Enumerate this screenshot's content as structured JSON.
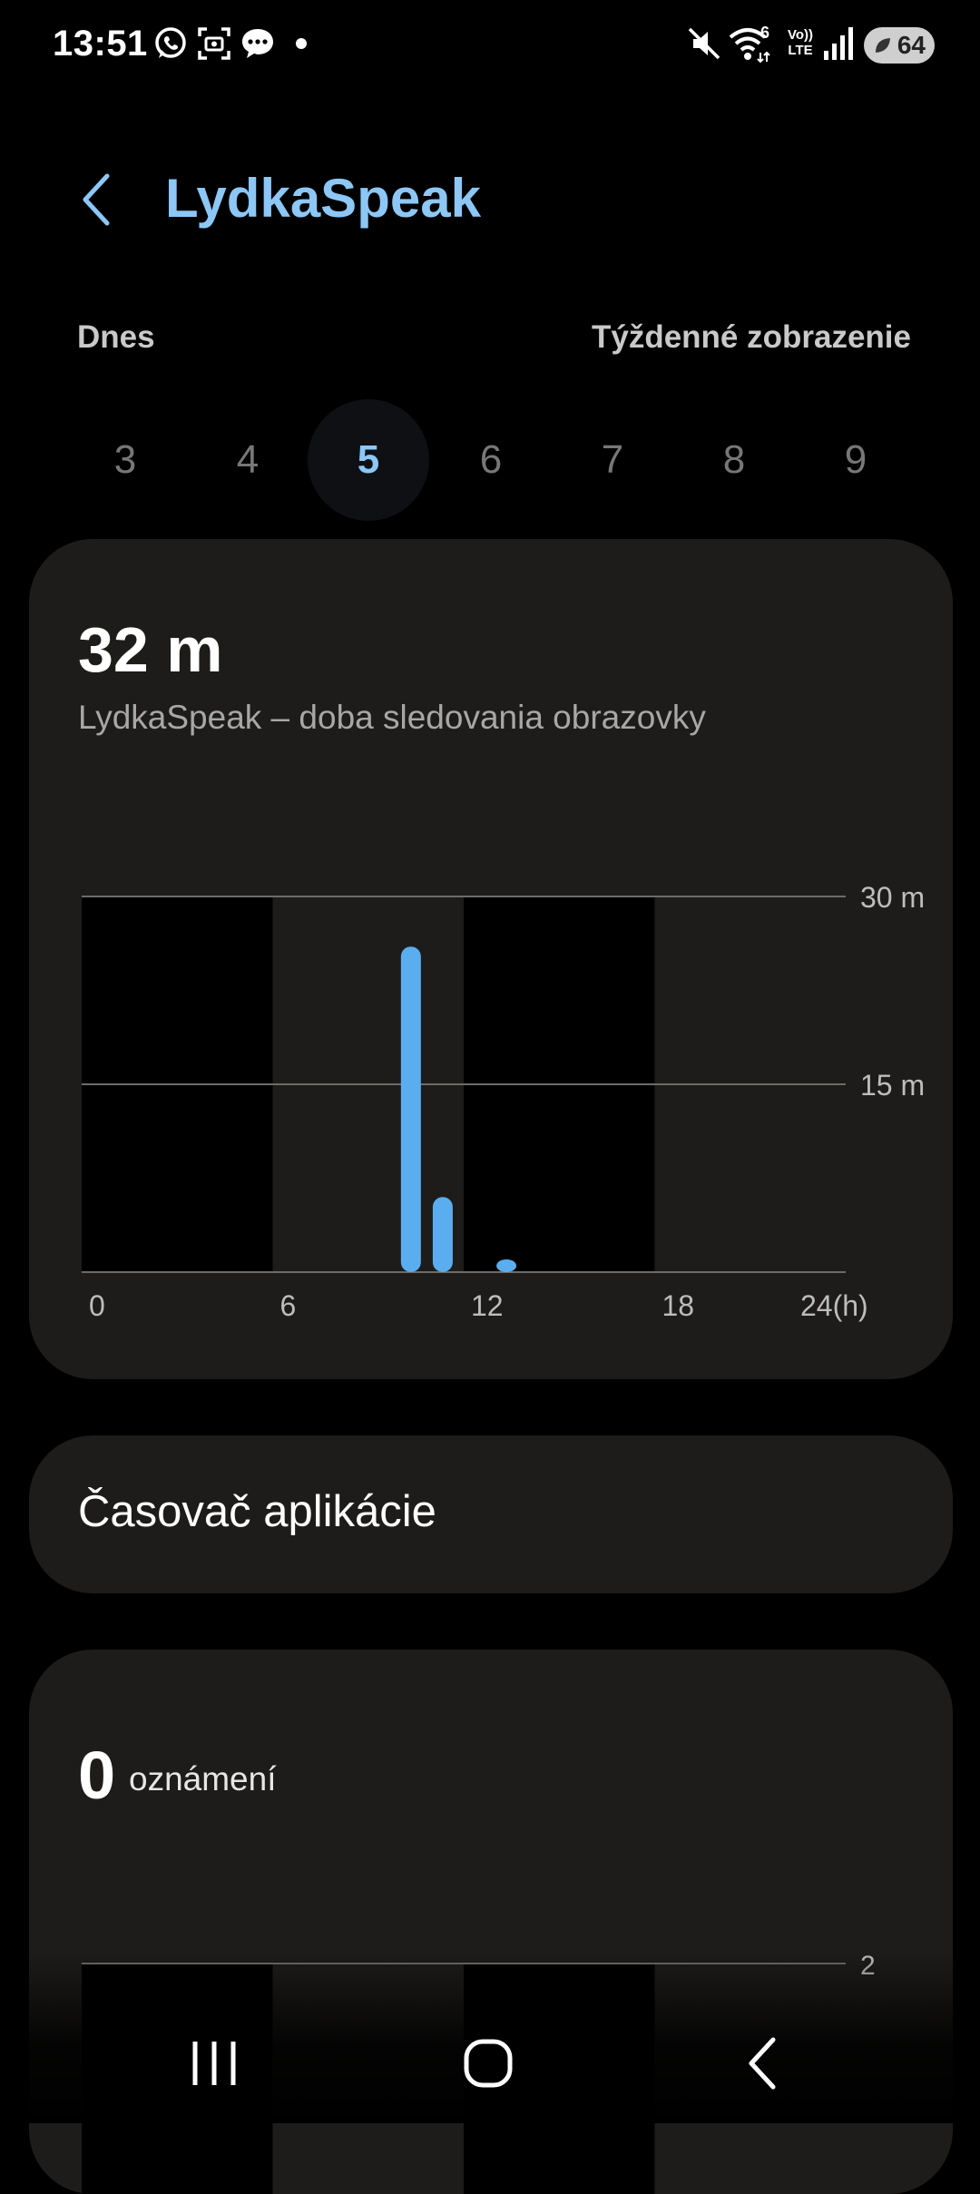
{
  "status_bar": {
    "time": "13:51",
    "battery": "64",
    "icons": [
      "whatsapp-icon",
      "screenshot-icon",
      "messages-icon",
      "mute-icon",
      "wifi-icon",
      "volte-icon",
      "signal-icon",
      "battery-icon"
    ],
    "wifi_badge": "6",
    "volte_top": "Vo))",
    "volte_bottom": "LTE"
  },
  "header": {
    "title": "LydkaSpeak"
  },
  "range": {
    "today_label": "Dnes",
    "weekly_label": "Týždenné zobrazenie"
  },
  "days": [
    "3",
    "4",
    "5",
    "6",
    "7",
    "8",
    "9"
  ],
  "selected_day": "5",
  "usage": {
    "value": "32 m",
    "subtitle": "LydkaSpeak – doba sledovania obrazovky"
  },
  "chart_data": {
    "type": "bar",
    "x_unit": "hour",
    "x": [
      10,
      11,
      13
    ],
    "values": [
      26,
      6,
      1
    ],
    "ylim": [
      0,
      30
    ],
    "yticks": [
      "30 m",
      "15 m"
    ],
    "ytick_values": [
      30,
      15
    ],
    "xticks": [
      "0",
      "6",
      "12",
      "18",
      "24(h)"
    ],
    "xtick_values": [
      0,
      6,
      12,
      18,
      24
    ],
    "xlim": [
      0,
      24
    ],
    "bar_color": "#5aaef0",
    "grid": true
  },
  "timer": {
    "label": "Časovač aplikácie"
  },
  "notifications": {
    "count": "0",
    "label": "oznámení",
    "ytick": "2"
  },
  "colors": {
    "accent": "#8cc7f6",
    "card_bg": "#1e1c1a",
    "bar": "#5aaef0"
  }
}
